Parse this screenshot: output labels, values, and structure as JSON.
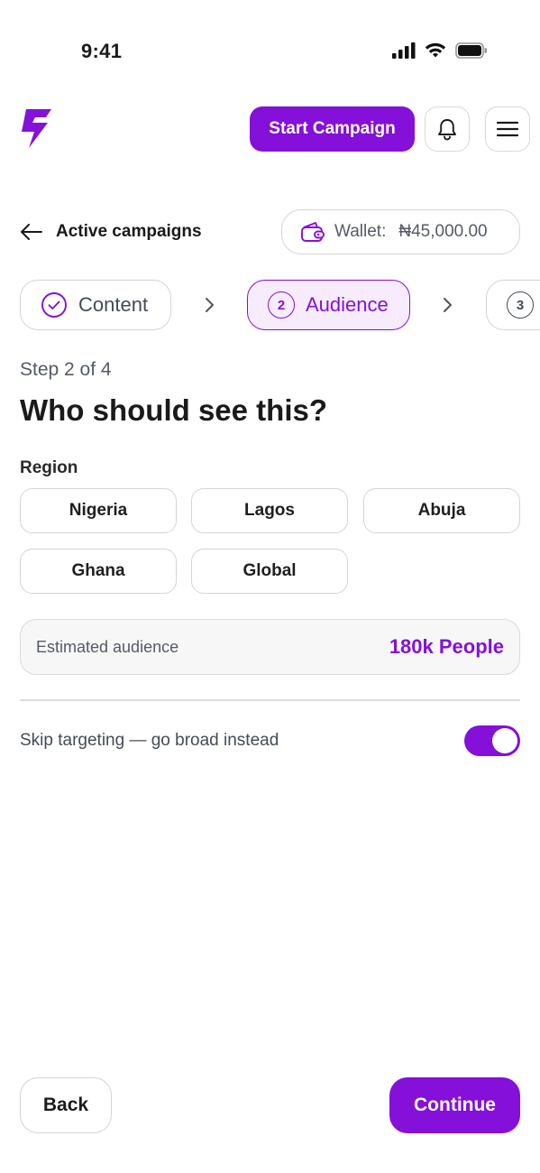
{
  "status": {
    "time": "9:41",
    "icons": [
      "signal-icon",
      "wifi-icon",
      "battery-icon"
    ]
  },
  "header": {
    "start_campaign_label": "Start Campaign",
    "icons": [
      "logo-bolt-icon",
      "bell-icon",
      "menu-icon"
    ]
  },
  "nav": {
    "back_label": "Active campaigns",
    "wallet_label": "Wallet:",
    "wallet_amount": "₦45,000.00"
  },
  "stepper": {
    "steps": [
      {
        "number": "",
        "label": "Content",
        "state": "completed"
      },
      {
        "number": "2",
        "label": "Audience",
        "state": "active"
      },
      {
        "number": "3",
        "label": "",
        "state": "upcoming"
      }
    ]
  },
  "main": {
    "step_text": "Step 2 of 4",
    "title": "Who should see this?",
    "region_label": "Region",
    "regions": [
      "Nigeria",
      "Lagos",
      "Abuja",
      "Ghana",
      "Global"
    ],
    "estimate_label": "Estimated audience",
    "estimate_value": "180k People",
    "skip_label": "Skip targeting — go broad instead",
    "skip_enabled": true
  },
  "footer": {
    "back_label": "Back",
    "continue_label": "Continue"
  },
  "colors": {
    "accent": "#8410d9",
    "accent_soft": "#f6ecfd",
    "border": "#d5d5d5"
  }
}
